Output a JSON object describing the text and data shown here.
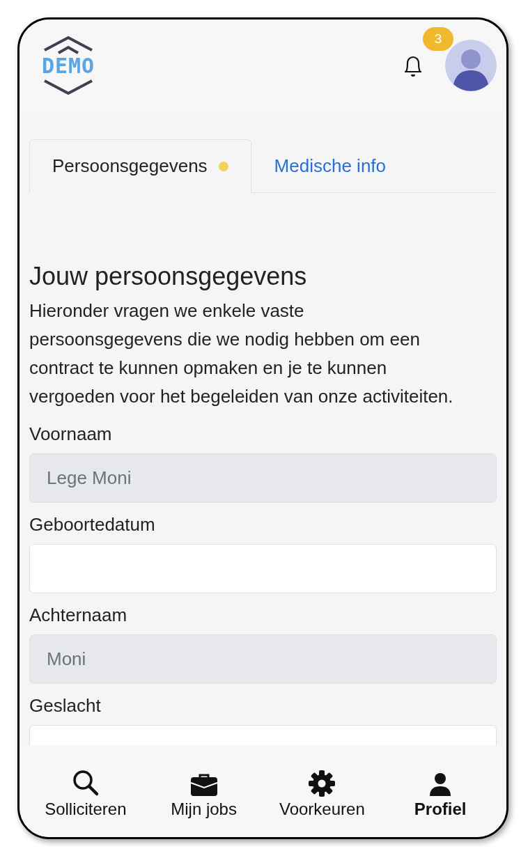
{
  "header": {
    "logo_text": "DEMO",
    "notification_count": "3"
  },
  "tabs": [
    {
      "label": "Persoonsgegevens",
      "selected": true,
      "attention": true
    },
    {
      "label": "Medische info",
      "selected": false,
      "attention": false
    }
  ],
  "section": {
    "title": "Jouw persoonsgegevens",
    "intro": "Hieronder vragen we enkele vaste persoonsgegevens die we nodig hebben om een contract te kunnen opmaken en je te kunnen vergoeden voor het begeleiden van onze activiteiten."
  },
  "fields": [
    {
      "label": "Voornaam",
      "value": "Lege Moni",
      "disabled": true
    },
    {
      "label": "Geboortedatum",
      "disabled": false
    },
    {
      "label": "Achternaam",
      "value": "Moni",
      "disabled": true
    },
    {
      "label": "Geslacht",
      "disabled": false
    }
  ],
  "bottom_nav": [
    {
      "label": "Solliciteren",
      "kind": "search",
      "selected": false
    },
    {
      "label": "Mijn jobs",
      "kind": "briefcase",
      "selected": false
    },
    {
      "label": "Voorkeuren",
      "kind": "gear",
      "selected": false
    },
    {
      "label": "Profiel",
      "kind": "person",
      "selected": true
    }
  ]
}
